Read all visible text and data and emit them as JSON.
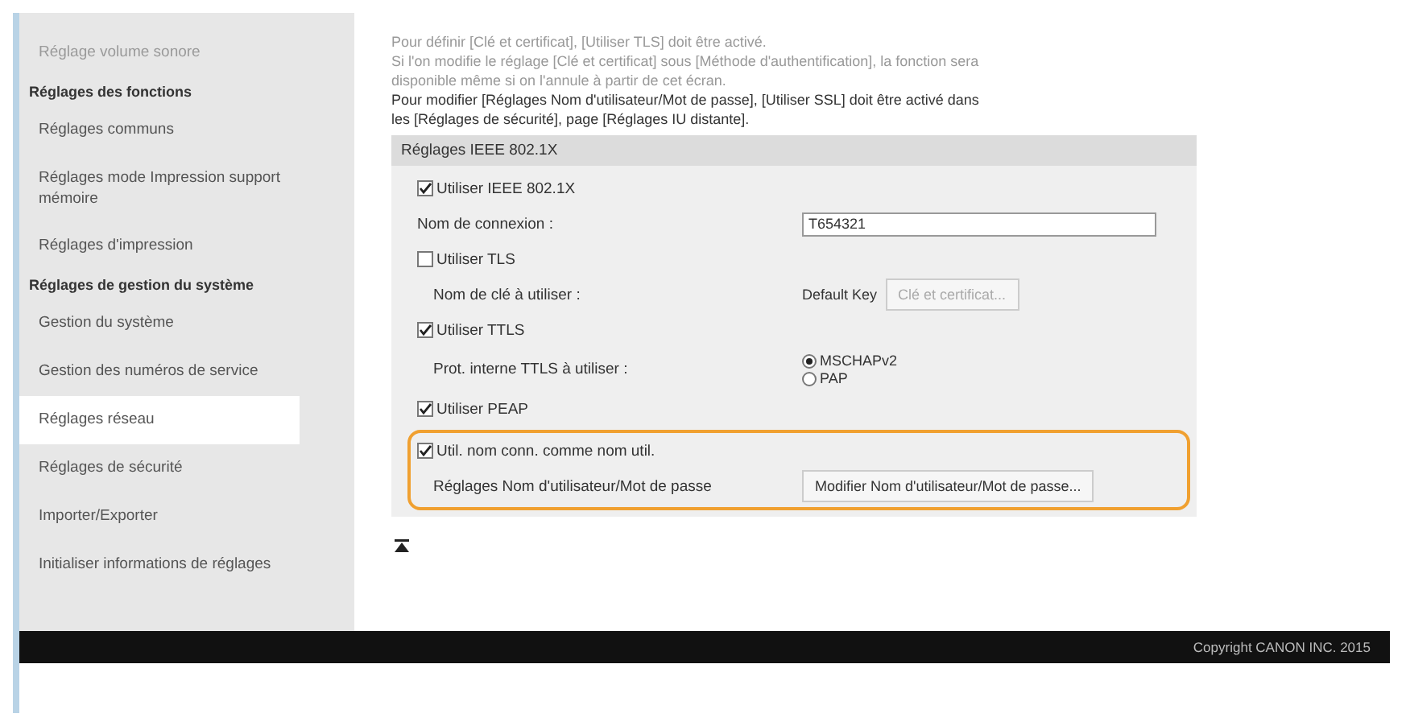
{
  "sidebar": {
    "items": [
      {
        "kind": "item",
        "label": "Réglage volume sonore",
        "selected": false,
        "faded": true
      },
      {
        "kind": "header",
        "label": "Réglages des fonctions",
        "faded": false
      },
      {
        "kind": "item",
        "label": "Réglages communs",
        "selected": false,
        "faded": false
      },
      {
        "kind": "item",
        "label": "Réglages mode Impression support mémoire",
        "selected": false,
        "faded": false
      },
      {
        "kind": "item",
        "label": "Réglages d'impression",
        "selected": false,
        "faded": false
      },
      {
        "kind": "header",
        "label": "Réglages de gestion du système",
        "faded": false
      },
      {
        "kind": "item",
        "label": "Gestion du système",
        "selected": false,
        "faded": false
      },
      {
        "kind": "item",
        "label": "Gestion des numéros de service",
        "selected": false,
        "faded": false
      },
      {
        "kind": "item",
        "label": "Réglages réseau",
        "selected": true,
        "faded": false
      },
      {
        "kind": "item",
        "label": "Réglages de sécurité",
        "selected": false,
        "faded": false
      },
      {
        "kind": "item",
        "label": "Importer/Exporter",
        "selected": false,
        "faded": false
      },
      {
        "kind": "item",
        "label": "Initialiser informations de réglages",
        "selected": false,
        "faded": false
      }
    ]
  },
  "notes": [
    {
      "text": "Pour définir [Clé et certificat], [Utiliser TLS] doit être activé.",
      "faded": true
    },
    {
      "text": "Si l'on modifie le réglage [Clé et certificat] sous [Méthode d'authentification], la fonction sera disponible même si on l'annule à partir de cet écran.",
      "faded": true
    },
    {
      "text": "Pour modifier [Réglages Nom d'utilisateur/Mot de passe], [Utiliser SSL] doit être activé dans les [Réglages de sécurité], page [Réglages IU distante].",
      "faded": false
    }
  ],
  "section": {
    "title": "Réglages IEEE 802.1X",
    "rows": [
      {
        "kind": "checkbox",
        "label": "Utiliser IEEE 802.1X",
        "checked": true
      },
      {
        "kind": "field",
        "label": "Nom de connexion :",
        "value": "T654321",
        "indented": false
      },
      {
        "kind": "checkbox",
        "label": "Utiliser TLS",
        "checked": false
      },
      {
        "kind": "key",
        "label": "Nom de clé à utiliser :",
        "key": "Default Key",
        "button": "Clé et certificat...",
        "indented": true,
        "button_disabled": true
      },
      {
        "kind": "checkbox",
        "label": "Utiliser TTLS",
        "checked": true
      },
      {
        "kind": "radios",
        "label": "Prot. interne TTLS à utiliser :",
        "indented": true,
        "options": [
          {
            "label": "MSCHAPv2",
            "selected": true
          },
          {
            "label": "PAP",
            "selected": false
          }
        ]
      },
      {
        "kind": "checkbox",
        "label": "Utiliser PEAP",
        "checked": true
      }
    ],
    "highlighted_rows": [
      {
        "kind": "checkbox",
        "label": "Util. nom conn. comme nom util.",
        "checked": true
      },
      {
        "kind": "key",
        "label": "Réglages Nom d'utilisateur/Mot de passe",
        "button": "Modifier Nom d'utilisateur/Mot de passe...",
        "indented": true,
        "button_disabled": false
      }
    ]
  },
  "footer": {
    "copyright": "Copyright CANON INC. 2015"
  }
}
